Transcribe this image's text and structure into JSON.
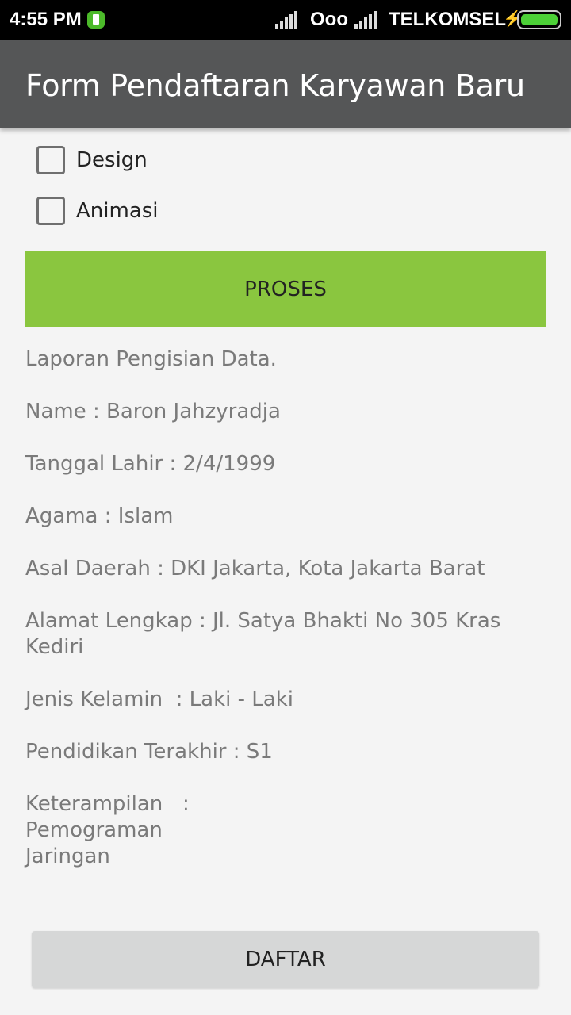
{
  "status_bar": {
    "time": "4:55 PM",
    "carrier1": "Ooo",
    "carrier2": "TELKOMSEL"
  },
  "app_bar": {
    "title": "Form Pendaftaran Karyawan Baru"
  },
  "checkboxes": [
    {
      "label": "Design",
      "checked": false
    },
    {
      "label": "Animasi",
      "checked": false
    }
  ],
  "proses_button": "PROSES",
  "report": {
    "header": "Laporan Pengisian Data.",
    "name": "Name : Baron Jahzyradja",
    "birth_date": "Tanggal Lahir : 2/4/1999",
    "religion": "Agama : Islam",
    "origin": "Asal Daerah : DKI Jakarta, Kota Jakarta Barat",
    "address": "Alamat Lengkap : Jl. Satya Bhakti No 305 Kras\nKediri",
    "gender": "Jenis Kelamin  : Laki - Laki",
    "education": "Pendidikan Terakhir : S1",
    "skills": "Keterampilan   :\nPemograman\nJaringan"
  },
  "daftar_button": "DAFTAR",
  "colors": {
    "app_bar": "#555657",
    "proses_button": "#8ac63f",
    "daftar_button": "#d6d7d7",
    "background": "#f4f4f4"
  }
}
